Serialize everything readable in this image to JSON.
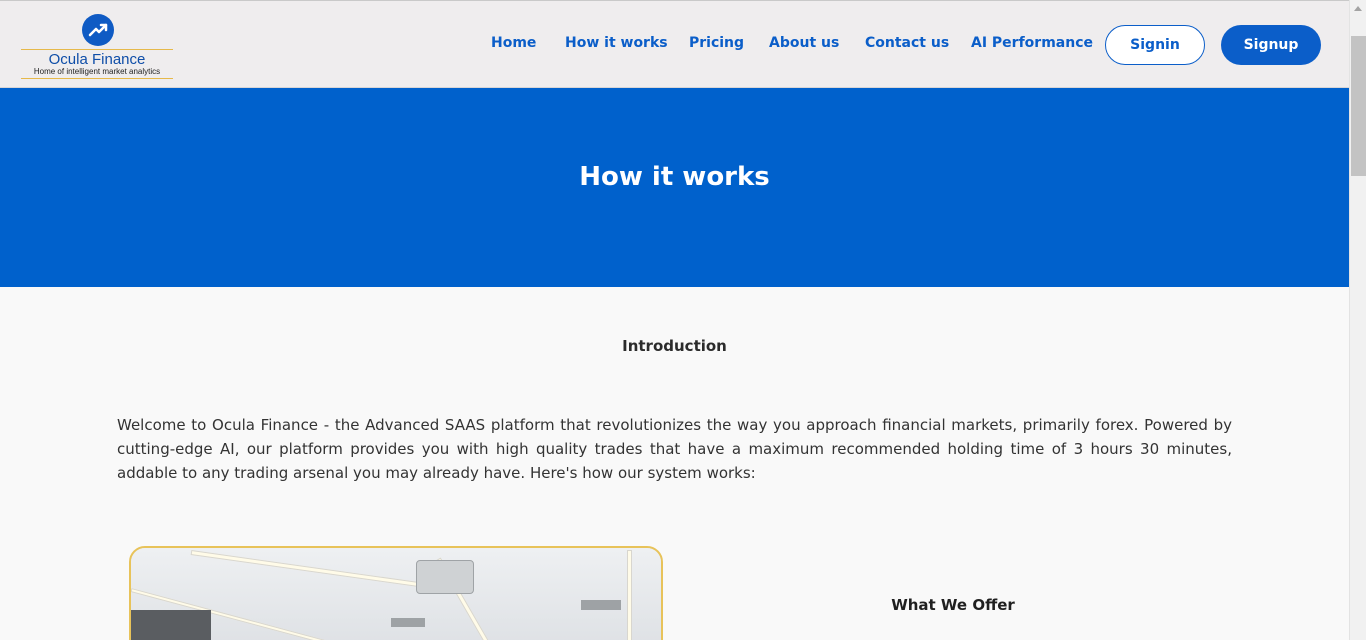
{
  "brand": {
    "name": "Ocula Finance",
    "tagline": "Home of intelligent market analytics",
    "logo_icon": "trend-up-icon"
  },
  "nav": {
    "items": [
      {
        "label": "Home"
      },
      {
        "label": "How it works"
      },
      {
        "label": "Pricing"
      },
      {
        "label": "About us"
      },
      {
        "label": "Contact us"
      },
      {
        "label": "AI Performance"
      }
    ],
    "signin_label": "Signin",
    "signup_label": "Signup"
  },
  "hero": {
    "title": "How it works"
  },
  "intro": {
    "heading": "Introduction",
    "body": "Welcome to Ocula Finance - the Advanced SAAS platform that revolutionizes the way you approach financial markets, primarily forex. Powered by cutting-edge AI, our platform provides you with high quality trades that have a maximum recommended holding time of 3 hours 30 minutes, addable to any trading arsenal you may already have. Here's how our system works:"
  },
  "offer": {
    "heading": "What We Offer"
  },
  "colors": {
    "primary": "#0061cc",
    "nav_bg": "#efedee",
    "accent_gold": "#e8c35a"
  }
}
